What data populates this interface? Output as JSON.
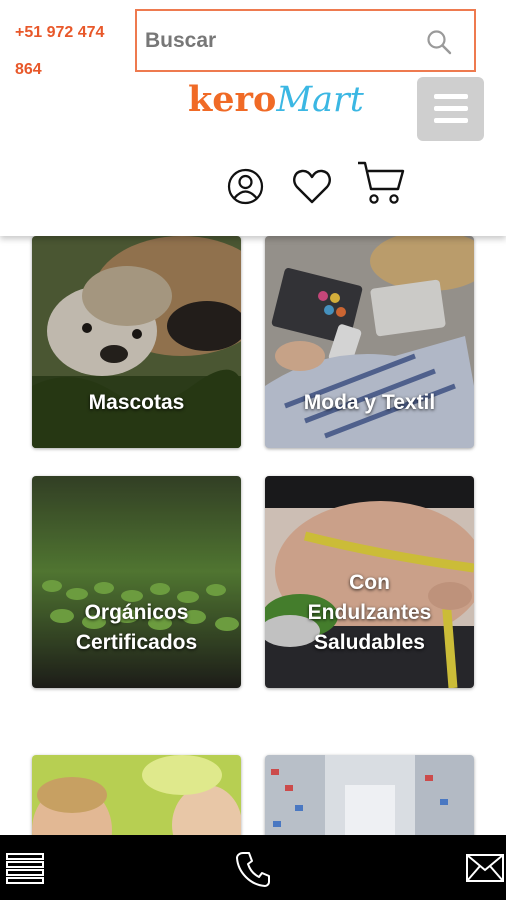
{
  "header": {
    "phone": "+51 972 474 864",
    "search": {
      "placeholder": "Buscar"
    },
    "logo": {
      "part1": "kero",
      "part2": "Mart"
    },
    "icons": [
      "search-icon",
      "menu-icon",
      "user-icon",
      "heart-icon",
      "cart-icon"
    ]
  },
  "categories": [
    {
      "label": "Mascotas"
    },
    {
      "label": "Moda y Textil"
    },
    {
      "label": "Orgánicos\nCertificados"
    },
    {
      "label": "Con\nEndulzantes\nSaludables"
    },
    {
      "label": ""
    },
    {
      "label": ""
    }
  ],
  "bottom_bar": {
    "icons": [
      "menu-icon",
      "phone-icon",
      "mail-icon"
    ]
  },
  "colors": {
    "brand_orange": "#f06a26",
    "brand_blue": "#3bb7e3",
    "search_border": "#ee7a4f",
    "bottom_bar": "#000000"
  }
}
